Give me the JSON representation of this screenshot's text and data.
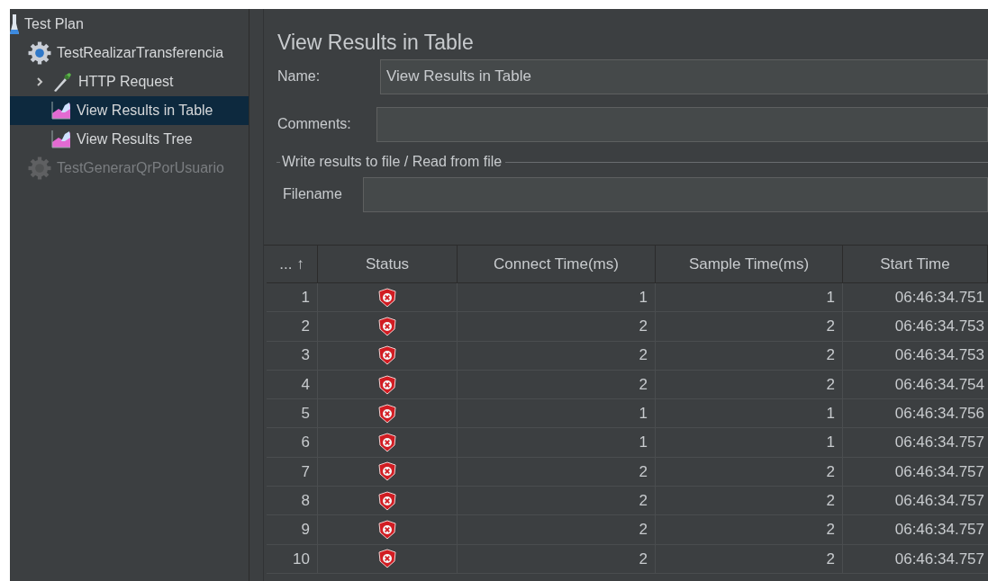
{
  "tree": [
    {
      "label": "Test Plan",
      "kind": "plan",
      "selected": false,
      "disabled": false,
      "children": [
        {
          "label": "TestRealizarTransferencia",
          "kind": "thread_group",
          "selected": false,
          "disabled": false,
          "children": [
            {
              "label": "HTTP Request",
              "kind": "sampler",
              "selected": false,
              "disabled": false,
              "expanded": false
            },
            {
              "label": "View Results in Table",
              "kind": "listener",
              "selected": true,
              "disabled": false
            },
            {
              "label": "View Results Tree",
              "kind": "listener",
              "selected": false,
              "disabled": false
            }
          ]
        },
        {
          "label": "TestGenerarQrPorUsuario",
          "kind": "thread_group",
          "selected": false,
          "disabled": true
        }
      ]
    }
  ],
  "panel": {
    "title": "View Results in Table",
    "name_label": "Name:",
    "name_value": "View Results in Table",
    "comments_label": "Comments:",
    "group_title": "Write results to file / Read from file",
    "filename_label": "Filename"
  },
  "table": {
    "columns": [
      {
        "label": "... ↑"
      },
      {
        "label": "Status"
      },
      {
        "label": "Connect Time(ms)"
      },
      {
        "label": "Sample Time(ms)"
      },
      {
        "label": "Start Time"
      }
    ],
    "rows": [
      {
        "num": "1",
        "success": false,
        "connect": "1",
        "sample": "1",
        "start": "06:46:34.751"
      },
      {
        "num": "2",
        "success": false,
        "connect": "2",
        "sample": "2",
        "start": "06:46:34.753"
      },
      {
        "num": "3",
        "success": false,
        "connect": "2",
        "sample": "2",
        "start": "06:46:34.753"
      },
      {
        "num": "4",
        "success": false,
        "connect": "2",
        "sample": "2",
        "start": "06:46:34.754"
      },
      {
        "num": "5",
        "success": false,
        "connect": "1",
        "sample": "1",
        "start": "06:46:34.756"
      },
      {
        "num": "6",
        "success": false,
        "connect": "1",
        "sample": "1",
        "start": "06:46:34.757"
      },
      {
        "num": "7",
        "success": false,
        "connect": "2",
        "sample": "2",
        "start": "06:46:34.757"
      },
      {
        "num": "8",
        "success": false,
        "connect": "2",
        "sample": "2",
        "start": "06:46:34.757"
      },
      {
        "num": "9",
        "success": false,
        "connect": "2",
        "sample": "2",
        "start": "06:46:34.757"
      },
      {
        "num": "10",
        "success": false,
        "connect": "2",
        "sample": "2",
        "start": "06:46:34.757"
      }
    ]
  }
}
